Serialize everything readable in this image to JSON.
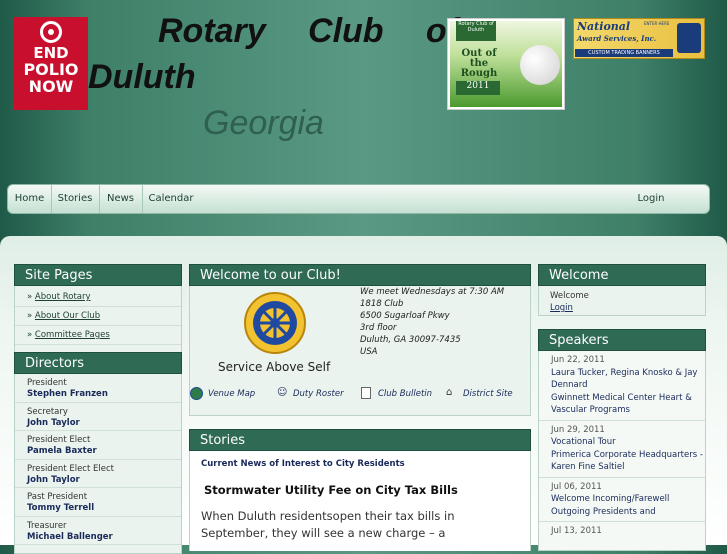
{
  "header": {
    "logo_lines": [
      "END",
      "POLIO",
      "NOW"
    ],
    "title_words": [
      "Rotary",
      "Club",
      "of"
    ],
    "title_line2": "Duluth",
    "title_line3": "Georgia",
    "ad_golf": {
      "top_label": "Rotary Club of Duluth",
      "headline": "Out of the Rough",
      "year": "2011"
    },
    "ad_national": {
      "name_line1": "National",
      "name_line2": "Award Services, Inc.",
      "banner": "CUSTOM TRADING BANNERS",
      "corner": "ENTER HERE"
    }
  },
  "nav": {
    "items": [
      "Home",
      "Stories",
      "News",
      "Calendar"
    ],
    "login": "Login"
  },
  "site_pages": {
    "title": "Site Pages",
    "links": [
      "About Rotary",
      "About Our Club",
      "Committee Pages"
    ]
  },
  "directors": {
    "title": "Directors",
    "people": [
      {
        "role": "President",
        "name": "Stephen Franzen"
      },
      {
        "role": "Secretary",
        "name": "John Taylor"
      },
      {
        "role": "President Elect",
        "name": "Pamela Baxter"
      },
      {
        "role": "President Elect Elect",
        "name": "John Taylor"
      },
      {
        "role": "Past President",
        "name": "Tommy Terrell"
      },
      {
        "role": "Treasurer",
        "name": "Michael Ballenger"
      }
    ]
  },
  "welcome_club": {
    "title": "Welcome to our Club!",
    "motto": "Service Above Self",
    "meeting": [
      "We meet Wednesdays at 7:30 AM",
      "1818 Club",
      "6500 Sugarloaf Pkwy",
      "3rd floor",
      "Duluth, GA 30097-7435",
      "USA"
    ],
    "links": [
      "Venue Map",
      "Duty Roster",
      "Club Bulletin",
      "District Site"
    ]
  },
  "stories": {
    "title": "Stories",
    "subheading": "Current News of Interest to City Residents",
    "headline": "Stormwater Utility Fee on City Tax Bills",
    "body": "When Duluth residentsopen their tax bills in September, they will see a new charge – a stormwaterutility fee – on it. For"
  },
  "welcome_box": {
    "title": "Welcome",
    "text": "Welcome",
    "login": "Login"
  },
  "speakers": {
    "title": "Speakers",
    "items": [
      {
        "date": "Jun 22, 2011",
        "lines": [
          "Laura Tucker, Regina Knosko & Jay Dennard",
          "Gwinnett Medical Center Heart & Vascular Programs"
        ]
      },
      {
        "date": "Jun 29, 2011",
        "lines": [
          "Vocational Tour",
          "Primerica Corporate Headquarters - Karen Fine Saltiel"
        ]
      },
      {
        "date": "Jul 06, 2011",
        "lines": [
          "Welcome Incoming/Farewell Outgoing Presidents and"
        ]
      },
      {
        "date": "Jul 13, 2011",
        "lines": []
      }
    ]
  }
}
